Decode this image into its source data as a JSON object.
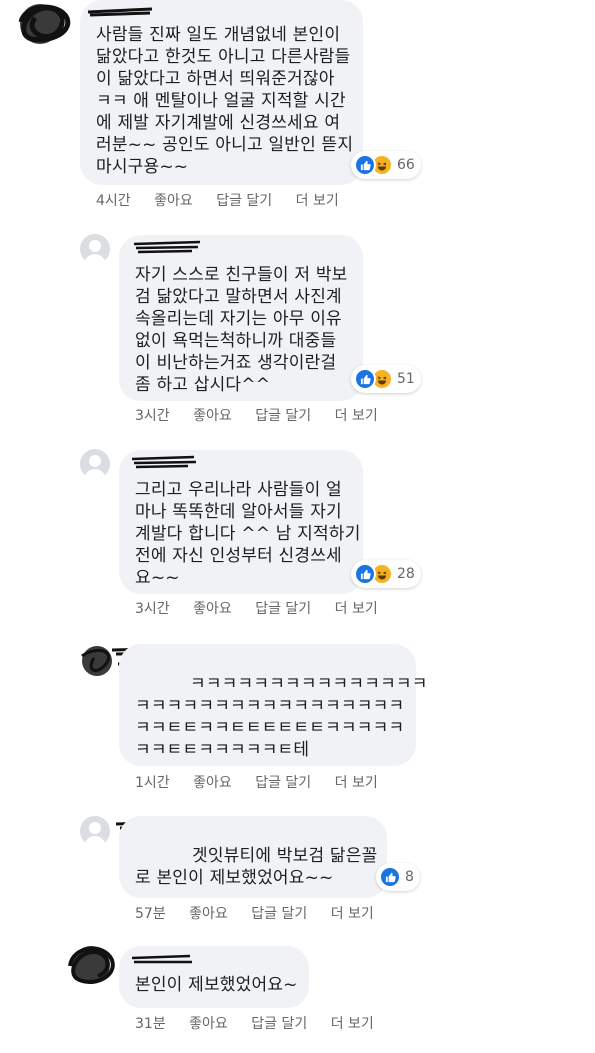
{
  "comments": [
    {
      "author": "",
      "text": "사람들 진짜 일도 개념없네 본인이\n닮았다고 한것도 아니고 다른사람들\n이 닮았다고 하면서 띄워준거잖아\nㅋㅋ 애 멘탈이나 얼굴 지적할 시간\n에 제발 자기계발에 신경쓰세요 여\n러분~~ 공인도 아니고 일반인 뜯지\n마시구용~~",
      "reactions": [
        "like-icon",
        "haha-icon"
      ],
      "reaction_count": "66",
      "time": "4시간",
      "like_label": "좋아요",
      "reply_label": "답글 달기",
      "more_label": "더 보기"
    },
    {
      "author": "",
      "text": "자기 스스로 친구들이 저 박보\n검 닮았다고 말하면서 사진계\n속올리는데 자기는 아무 이유\n없이 욕먹는척하니까 대중들\n이 비난하는거죠 생각이란걸\n좀 하고 삽시다^^",
      "reactions": [
        "like-icon",
        "haha-icon"
      ],
      "reaction_count": "51",
      "time": "3시간",
      "like_label": "좋아요",
      "reply_label": "답글 달기",
      "more_label": "더 보기"
    },
    {
      "author": "",
      "text": "그리고 우리나라 사람들이 얼\n마나 똑똑한데 알아서들 자기\n계발다 합니다 ^^ 남 지적하기\n전에 자신 인성부터 신경쓰세\n요~~",
      "reactions": [
        "like-icon",
        "haha-icon"
      ],
      "reaction_count": "28",
      "time": "3시간",
      "like_label": "좋아요",
      "reply_label": "답글 달기",
      "more_label": "더 보기"
    },
    {
      "author": "",
      "text_first_line": "ㅋㅋㅋㅋㅋㅋㅋㅋㅋㅋㅋㅋㅋㅋㅋ",
      "text": "ㅋㅋㅋㅋㅋㅋㅋㅋㅋㅋㅋㅋㅋㅋㅋㅋㅋ\nㅋㅋㅌㅌㅋㅋㅌㅌㅌㅌㅌㅌㅋㅋㅋㅋㅋ\nㅋㅋㅌㅌㅋㅋㅋㅋㅋㅌ테",
      "reactions": [],
      "reaction_count": "",
      "time": "1시간",
      "like_label": "좋아요",
      "reply_label": "답글 달기",
      "more_label": "더 보기"
    },
    {
      "author": "",
      "text_first_line": "겟잇뷰티에 박보검 닮은꼴",
      "text": "로 본인이 제보했었어요~~",
      "reactions": [
        "like-icon"
      ],
      "reaction_count": "8",
      "time": "57분",
      "like_label": "좋아요",
      "reply_label": "답글 달기",
      "more_label": "더 보기"
    },
    {
      "author": "",
      "text": "본인이 제보했었어요~",
      "reactions": [],
      "reaction_count": "",
      "time": "31분",
      "like_label": "좋아요",
      "reply_label": "답글 달기",
      "more_label": "더 보기"
    }
  ],
  "colors": {
    "bubble": "#f0f2f5",
    "meta_text": "#65676b",
    "like": "#1b74e4",
    "haha": "#f7b125",
    "redaction": "#111111"
  }
}
